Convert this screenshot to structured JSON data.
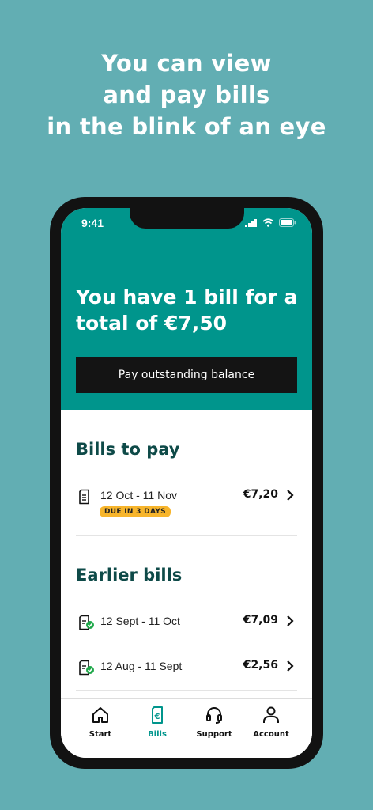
{
  "promo": {
    "line1": "You can view",
    "line2": "and pay bills",
    "line3": "in the blink of an eye"
  },
  "status": {
    "time": "9:41"
  },
  "hero": {
    "title": "You have 1 bill for a total of €7,50",
    "pay_button": "Pay outstanding balance"
  },
  "bills_to_pay": {
    "title": "Bills to pay",
    "items": [
      {
        "period": "12 Oct - 11 Nov",
        "amount": "€7,20",
        "badge": "DUE IN 3 DAYS"
      }
    ]
  },
  "earlier_bills": {
    "title": "Earlier bills",
    "items": [
      {
        "period": "12 Sept - 11 Oct",
        "amount": "€7,09"
      },
      {
        "period": "12 Aug - 11 Sept",
        "amount": "€2,56"
      }
    ]
  },
  "tabbar": {
    "items": [
      {
        "label": "Start",
        "icon": "home-icon"
      },
      {
        "label": "Bills",
        "icon": "bill-icon",
        "active": true
      },
      {
        "label": "Support",
        "icon": "headset-icon"
      },
      {
        "label": "Account",
        "icon": "person-icon"
      }
    ]
  },
  "colors": {
    "background": "#62aeb3",
    "brand": "#00958c",
    "heading": "#0e4a48",
    "badge": "#f7b52c"
  }
}
